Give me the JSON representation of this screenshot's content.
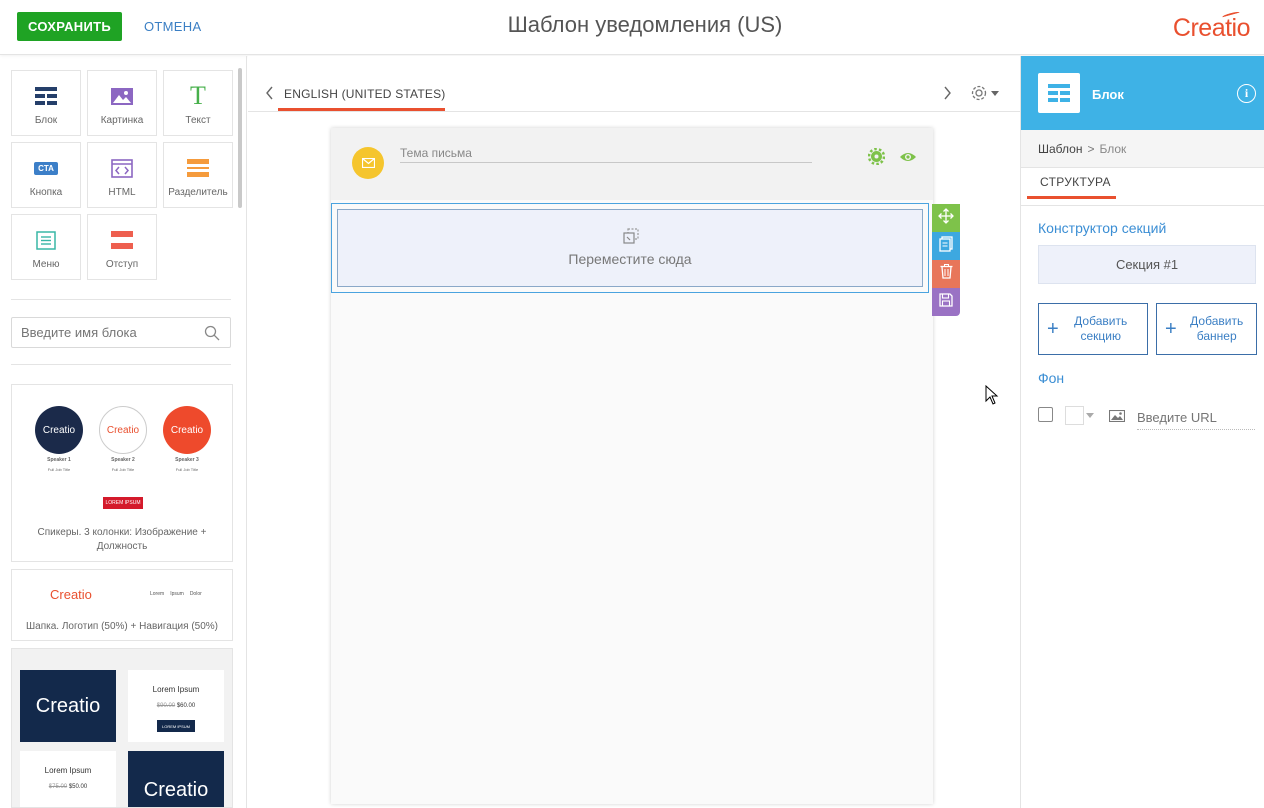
{
  "header": {
    "save_label": "СОХРАНИТЬ",
    "cancel_label": "ОТМЕНА",
    "title": "Шаблон уведомления (US)",
    "logo_text": "Creatio"
  },
  "blocks": [
    {
      "label": "Блок",
      "icon": "grid-icon"
    },
    {
      "label": "Картинка",
      "icon": "image-icon"
    },
    {
      "label": "Текст",
      "icon": "text-icon"
    },
    {
      "label": "Кнопка",
      "icon": "cta-icon",
      "badge": "CTA"
    },
    {
      "label": "HTML",
      "icon": "code-icon"
    },
    {
      "label": "Разделитель",
      "icon": "divider-icon"
    },
    {
      "label": "Меню",
      "icon": "menu-icon"
    },
    {
      "label": "Отступ",
      "icon": "spacer-icon"
    }
  ],
  "search": {
    "placeholder": "Введите имя блока"
  },
  "templates": [
    {
      "caption": "Спикеры. 3 колонки: Изображение + Должность",
      "speakers": [
        {
          "name": "Speaker 1",
          "title": "Full Job Title",
          "logo": "Creatio"
        },
        {
          "name": "Speaker 2",
          "title": "Full Job Title",
          "logo": "Creatio"
        },
        {
          "name": "Speaker 3",
          "title": "Full Job Title",
          "logo": "Creatio"
        }
      ],
      "button": "LOREM IPSUM"
    },
    {
      "caption": "Шапка. Логотип (50%) + Навигация (50%)",
      "logo": "Creatio",
      "nav": [
        "Lorem",
        "Ipsum",
        "Dolor"
      ]
    },
    {
      "product1": {
        "title": "Lorem Ipsum",
        "old_price": "$90.00",
        "price": "$60.00",
        "button": "LOREM IPSUM"
      },
      "product2": {
        "title": "Lorem Ipsum",
        "old_price": "$75.00",
        "price": "$50.00"
      },
      "logo": "Creatio"
    }
  ],
  "editor": {
    "language_tab": "ENGLISH (UNITED STATES)",
    "subject_placeholder": "Тема письма",
    "drop_text": "Переместите сюда"
  },
  "right_panel": {
    "title": "Блок",
    "breadcrumb": [
      "Шаблон",
      ">",
      "Блок"
    ],
    "tab": "СТРУКТУРА",
    "section_builder_label": "Конструктор секций",
    "section_item": "Секция #1",
    "add_section": "Добавить секцию",
    "add_banner": "Добавить баннер",
    "background_label": "Фон",
    "url_placeholder": "Введите URL"
  },
  "colors": {
    "save": "#1fa324",
    "accent": "#e9502f",
    "link": "#3b7fc4",
    "panel_header": "#3eb2e6",
    "move": "#7ec24a",
    "copy": "#3da8e0",
    "delete": "#e8765a",
    "store": "#9a72c4"
  }
}
